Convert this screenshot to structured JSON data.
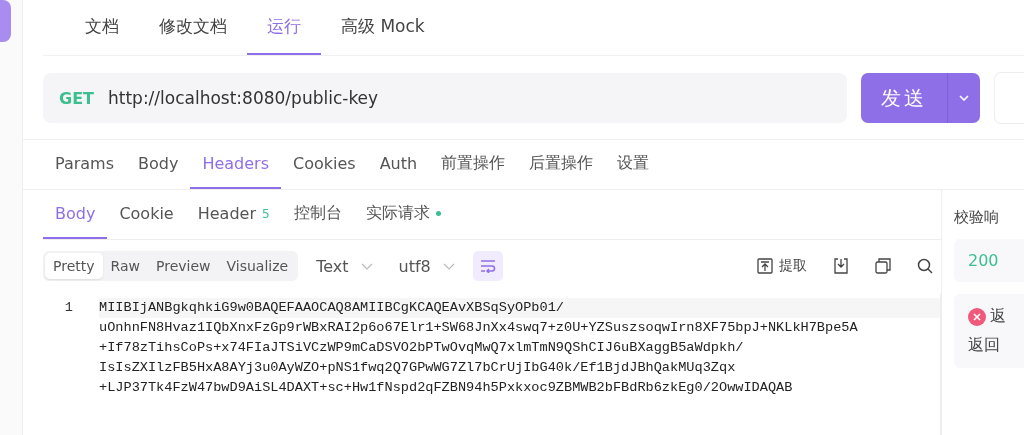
{
  "doc_tabs": [
    {
      "label": "文档",
      "selected": false
    },
    {
      "label": "修改文档",
      "selected": false
    },
    {
      "label": "运行",
      "selected": true
    },
    {
      "label": "高级 Mock",
      "selected": false
    }
  ],
  "request": {
    "method": "GET",
    "url": "http://localhost:8080/public-key",
    "send_button": "发送"
  },
  "request_tabs": [
    {
      "label": "Params",
      "selected": false
    },
    {
      "label": "Body",
      "selected": false
    },
    {
      "label": "Headers",
      "selected": true
    },
    {
      "label": "Cookies",
      "selected": false
    },
    {
      "label": "Auth",
      "selected": false
    },
    {
      "label": "前置操作",
      "selected": false
    },
    {
      "label": "后置操作",
      "selected": false
    },
    {
      "label": "设置",
      "selected": false
    }
  ],
  "response_tabs": [
    {
      "label": "Body",
      "selected": true,
      "dot": false
    },
    {
      "label": "Cookie",
      "selected": false,
      "dot": false
    },
    {
      "label": "Header",
      "badge": "5",
      "selected": false,
      "dot": false
    },
    {
      "label": "控制台",
      "selected": false,
      "dot": false
    },
    {
      "label": "实际请求",
      "selected": false,
      "dot": true
    }
  ],
  "view_modes": [
    {
      "label": "Pretty",
      "selected": true
    },
    {
      "label": "Raw",
      "selected": false
    },
    {
      "label": "Preview",
      "selected": false
    },
    {
      "label": "Visualize",
      "selected": false
    }
  ],
  "format": "Text",
  "encoding": "utf8",
  "wrap_on": true,
  "extract": "提取",
  "code": {
    "line_number": "1",
    "lines": [
      "MIIBIjANBgkqhkiG9w0BAQEFAAOCAQ8AMIIBCgKCAQEAvXBSqSyOPb01/",
      "uOnhnFN8Hvaz1IQbXnxFzGp9rWBxRAI2p6o67Elr1+SW68JnXx4swq7+z0U+YZSuszsoqwIrn8XF75bpJ+NKLkH7Bpe5A",
      "+If78zTihsCoPs+x74FIaJTSiVCzWP9mCaDSVO2bPTwOvqMwQ7xlmTmN9QShCIJ6uBXaggB5aWdpkh/",
      "IsIsZXIlzFB5HxA8AYj3u0AyWZO+pNS1fwq2Q7GPwWG7Zl7bCrUjIbG40k/Ef1BjdJBhQakMUq3Zqx",
      "+LJP37Tk4FzW47bwD9AiSL4DAXT+sc+Hw1fNspd2qFZBN94h5Pxkxoc9ZBMWB2bFBdRb6zkEg0/2OwwIDAQAB"
    ]
  },
  "right_panel": {
    "title": "校验响",
    "status": "200",
    "error_title": "返",
    "error_text": "返回"
  }
}
